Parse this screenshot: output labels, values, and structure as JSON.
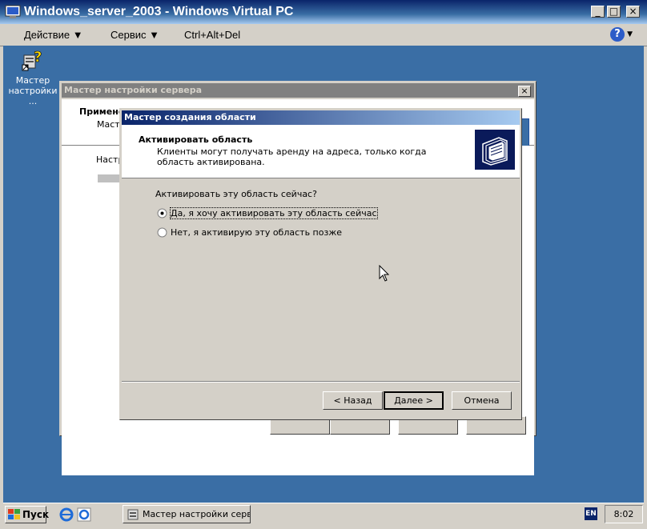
{
  "vpc": {
    "title": "Windows_server_2003 - Windows Virtual PC",
    "minimize_label": "_",
    "maximize_label": "□",
    "close_label": "×",
    "menu": [
      "Действие",
      "Сервис",
      "Ctrl+Alt+Del"
    ],
    "help_label": "?"
  },
  "desktop": {
    "icon_label_1": "Мастер",
    "icon_label_2": "настройки ..."
  },
  "bg_window": {
    "title": "Мастер настройки сервера",
    "close_label": "×",
    "header_title": "Примене",
    "header_sub": "Масте",
    "body_text": "Настр"
  },
  "dialog": {
    "title": "Мастер создания области",
    "header_title": "Активировать область",
    "header_desc": "Клиенты могут получать аренду на адреса, только когда область активирована.",
    "question": "Активировать эту область сейчас?",
    "options": [
      {
        "label": "Да, я хочу активировать эту область сейчас",
        "selected": true
      },
      {
        "label": "Нет, я активирую эту область позже",
        "selected": false
      }
    ],
    "buttons": {
      "back": "< Назад",
      "next": "Далее >",
      "cancel": "Отмена"
    }
  },
  "taskbar": {
    "start_label": "Пуск",
    "task_label": "Мастер настройки серв...",
    "lang": "EN",
    "clock": "8:02"
  },
  "colors": {
    "desktop": "#3a6ea5",
    "active_caption": "#0a246a",
    "face": "#d4d0c8"
  }
}
